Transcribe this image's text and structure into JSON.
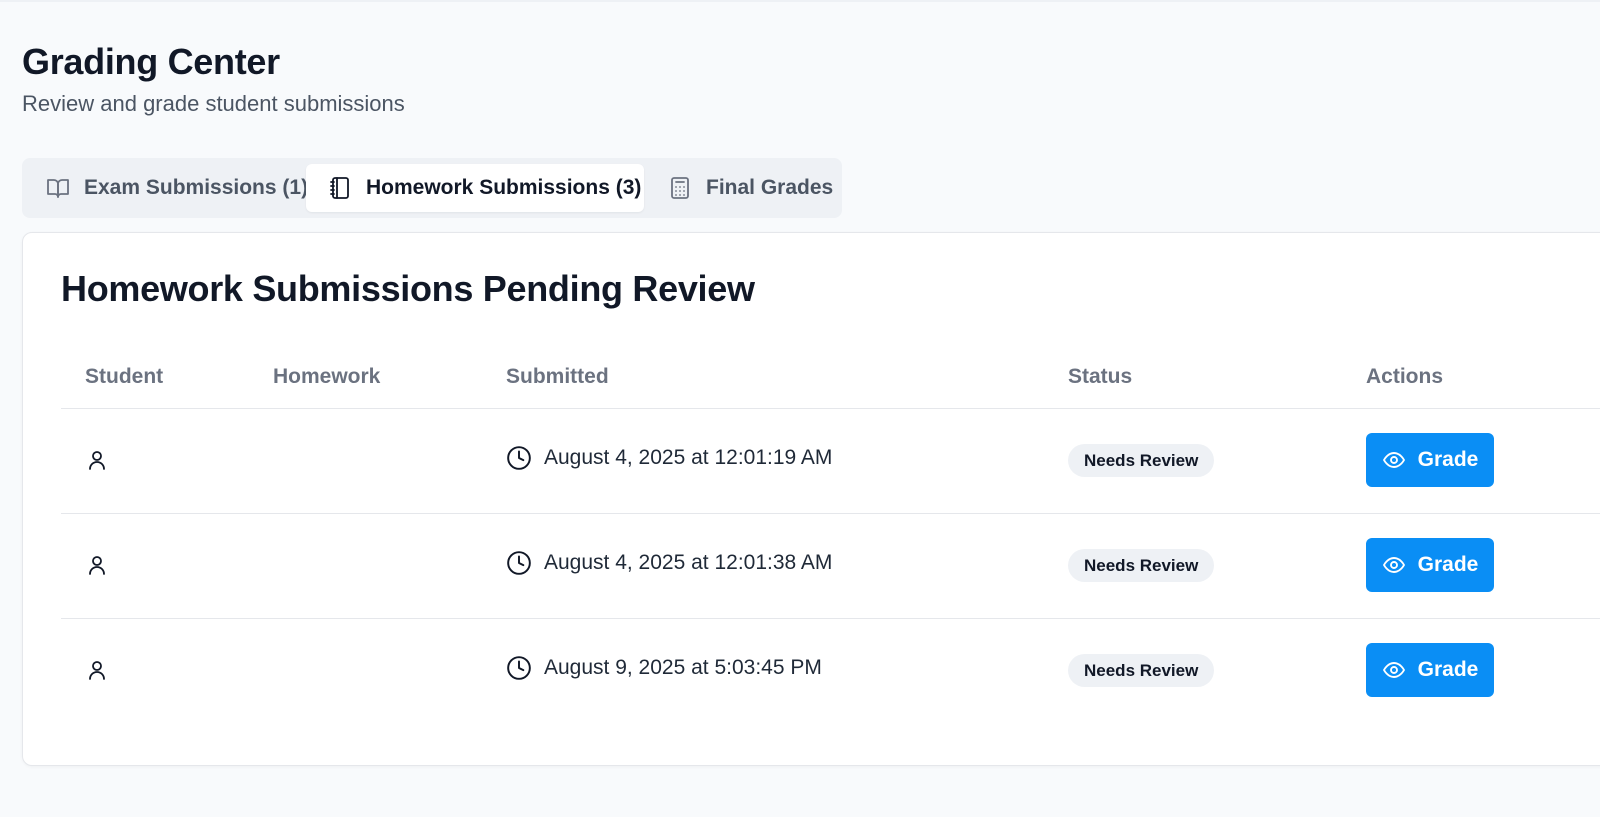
{
  "header": {
    "title": "Grading Center",
    "subtitle": "Review and grade student submissions"
  },
  "tabs": [
    {
      "label": "Exam Submissions (1)",
      "icon": "book-open-icon",
      "active": false
    },
    {
      "label": "Homework Submissions (3)",
      "icon": "notebook-icon",
      "active": true
    },
    {
      "label": "Final Grades",
      "icon": "calculator-icon",
      "active": false
    }
  ],
  "card": {
    "title": "Homework Submissions Pending Review"
  },
  "table": {
    "columns": [
      "Student",
      "Homework",
      "Submitted",
      "Status",
      "Actions"
    ],
    "rows": [
      {
        "student": "",
        "homework": "",
        "submitted": "August 4, 2025 at 12:01:19 AM",
        "status": "Needs Review",
        "action": "Grade"
      },
      {
        "student": "",
        "homework": "",
        "submitted": "August 4, 2025 at 12:01:38 AM",
        "status": "Needs Review",
        "action": "Grade"
      },
      {
        "student": "",
        "homework": "",
        "submitted": "August 9, 2025 at 5:03:45 PM",
        "status": "Needs Review",
        "action": "Grade"
      }
    ]
  },
  "colors": {
    "accent": "#0a8ef5",
    "background": "#f8fafc",
    "badge_bg": "#eef1f5"
  }
}
